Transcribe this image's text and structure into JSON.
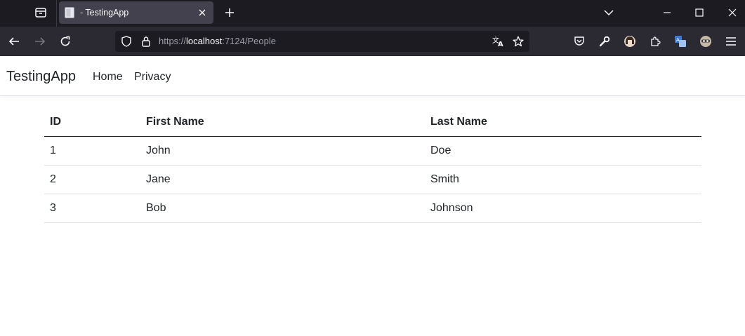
{
  "browser": {
    "tab": {
      "title": "- TestingApp",
      "favicon": "page-icon",
      "close": "close-icon"
    },
    "new_tab": "plus-icon",
    "window_controls": [
      "chevron-down-icon",
      "minimize-icon",
      "maximize-icon",
      "close-icon"
    ],
    "address": {
      "scheme": "https://",
      "host": "localhost",
      "rest": ":7124/People"
    },
    "colors": {
      "chrome": "#1c1b22",
      "toolbar": "#2b2a33",
      "active_tab": "#42414d"
    }
  },
  "site": {
    "brand": "TestingApp",
    "nav": [
      "Home",
      "Privacy"
    ]
  },
  "people_table": {
    "columns": [
      "ID",
      "First Name",
      "Last Name"
    ],
    "rows": [
      [
        "1",
        "John",
        "Doe"
      ],
      [
        "2",
        "Jane",
        "Smith"
      ],
      [
        "3",
        "Bob",
        "Johnson"
      ]
    ]
  }
}
